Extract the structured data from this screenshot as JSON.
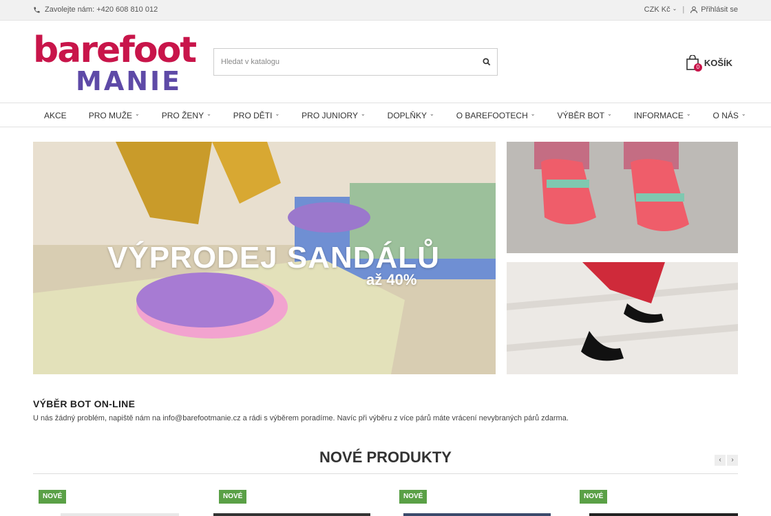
{
  "topbar": {
    "phone_text": "Zavolejte nám: +420 608 810 012",
    "currency": "CZK Kč",
    "separator": "|",
    "login": "Přihlásit se"
  },
  "header": {
    "logo_line1": "barefoot",
    "logo_line2": "MANIE",
    "search_placeholder": "Hledat v katalogu",
    "cart_label": "KOŠÍK",
    "cart_count": "0"
  },
  "nav": {
    "items": [
      {
        "label": "AKCE",
        "dropdown": false
      },
      {
        "label": "PRO MUŽE",
        "dropdown": true
      },
      {
        "label": "PRO ŽENY",
        "dropdown": true
      },
      {
        "label": "PRO DĚTI",
        "dropdown": true
      },
      {
        "label": "PRO JUNIORY",
        "dropdown": true
      },
      {
        "label": "DOPLŇKY",
        "dropdown": true
      },
      {
        "label": "O BAREFOOTECH",
        "dropdown": true
      },
      {
        "label": "VÝBĚR BOT",
        "dropdown": true
      },
      {
        "label": "INFORMACE",
        "dropdown": true
      },
      {
        "label": "O NÁS",
        "dropdown": true
      }
    ]
  },
  "banner": {
    "title": "VÝPRODEJ SANDÁLŮ",
    "subtitle": "až 40%"
  },
  "info": {
    "heading": "VÝBĚR BOT ON-LINE",
    "text": "U nás žádný problém, napiště nám na info@barefootmanie.cz a rádi s výběrem poradíme. Navíc při výběru z více párů máte vrácení nevybraných párů zdarma."
  },
  "new_products": {
    "title": "NOVÉ PRODUKTY",
    "prev_label": "‹",
    "next_label": "›",
    "badges": [
      "NOVÉ",
      "NOVÉ",
      "NOVÉ",
      "NOVÉ"
    ]
  },
  "colors": {
    "brand_pink": "#c8154a",
    "brand_purple": "#5e4aa7",
    "badge_green": "#5aa046"
  }
}
